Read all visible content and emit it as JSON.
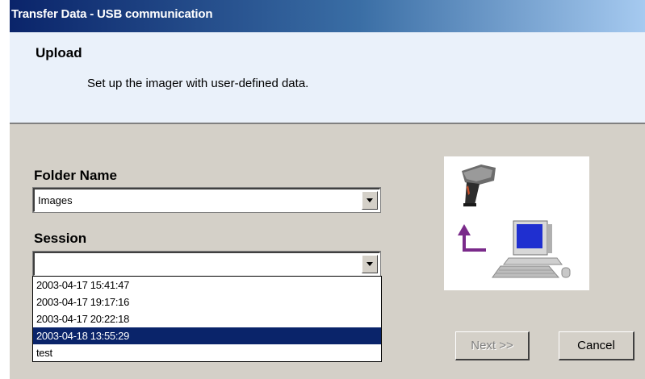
{
  "window": {
    "title": "Transfer Data - USB communication"
  },
  "header": {
    "title": "Upload",
    "subtitle": "Set up the imager with user-defined data."
  },
  "folder": {
    "label": "Folder Name",
    "value": "Images"
  },
  "session": {
    "label": "Session",
    "value": "",
    "options": [
      "2003-04-17 15:41:47",
      "2003-04-17 19:17:16",
      "2003-04-17 20:22:18",
      "2003-04-18 13:55:29",
      "test"
    ],
    "selected_index": 3
  },
  "buttons": {
    "next": "Next >>",
    "cancel": "Cancel"
  },
  "illustration": {
    "icons": [
      "barcode-scanner-icon",
      "upload-arrow-icon",
      "computer-icon"
    ]
  }
}
